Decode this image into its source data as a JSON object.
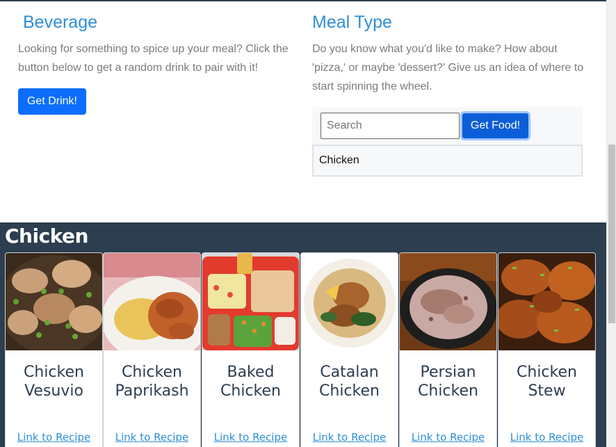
{
  "beverage": {
    "title": "Beverage",
    "description": "Looking for something to spice up your meal? Click the button below to get a random drink to pair with it!",
    "button_label": "Get Drink!"
  },
  "meal_type": {
    "title": "Meal Type",
    "description": "Do you know what you'd like to make? How about 'pizza,' or maybe 'dessert?' Give us an idea of where to start spinning the wheel.",
    "search_placeholder": "Search",
    "search_value": "",
    "button_label": "Get Food!",
    "suggestions": [
      "Chicken"
    ]
  },
  "results": {
    "title": "Chicken",
    "cards": [
      {
        "name": "Chicken Vesuvio",
        "link_label": "Link to Recipe"
      },
      {
        "name": "Chicken Paprikash",
        "link_label": "Link to Recipe"
      },
      {
        "name": "Baked Chicken",
        "link_label": "Link to Recipe"
      },
      {
        "name": "Catalan Chicken",
        "link_label": "Link to Recipe"
      },
      {
        "name": "Persian Chicken",
        "link_label": "Link to Recipe"
      },
      {
        "name": "Chicken Stew",
        "link_label": "Link to Recipe"
      }
    ]
  },
  "colors": {
    "heading": "#2f8fd6",
    "button": "#0d6efd",
    "results_bg": "#2c3e50"
  }
}
